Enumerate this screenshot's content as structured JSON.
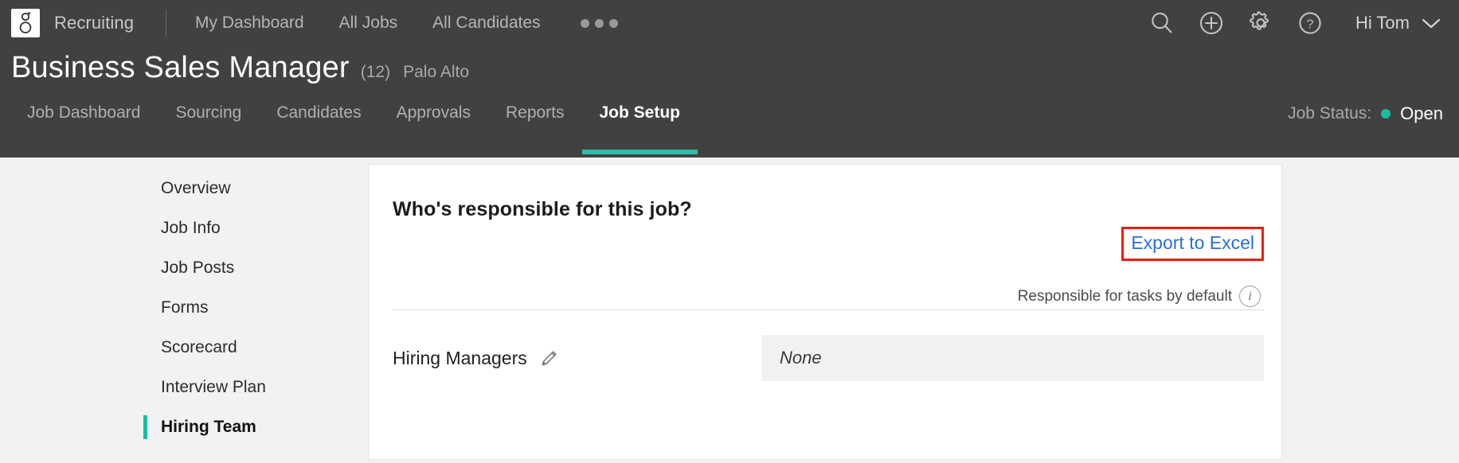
{
  "header": {
    "logo_icon": "greenhouse-g-logo-icon",
    "brand": "Recruiting",
    "nav_items": [
      {
        "label": "My Dashboard",
        "name": "my-dashboard"
      },
      {
        "label": "All Jobs",
        "name": "all-jobs"
      },
      {
        "label": "All Candidates",
        "name": "all-candidates"
      }
    ],
    "overflow_icon": "ellipsis-icon",
    "actions": [
      {
        "name": "search-icon",
        "label": "Search"
      },
      {
        "name": "plus-circle-icon",
        "label": "Create"
      },
      {
        "name": "gear-icon",
        "label": "Settings"
      },
      {
        "name": "question-circle-icon",
        "label": "Help"
      }
    ],
    "greeting": "Hi Tom",
    "greeting_caret_icon": "chevron-down-icon",
    "colors": {
      "topbar_bg": "#414141",
      "accent_teal": "#2bbfa8",
      "page_bg": "#f2f2f2"
    }
  },
  "job": {
    "title": "Business Sales Manager",
    "count": "(12)",
    "location": "Palo Alto",
    "status_label": "Job Status:",
    "status_value": "Open",
    "status_color": "#17bda0"
  },
  "tabs": [
    {
      "label": "Job Dashboard",
      "name": "job-dashboard",
      "active": false
    },
    {
      "label": "Sourcing",
      "name": "sourcing",
      "active": false
    },
    {
      "label": "Candidates",
      "name": "candidates",
      "active": false
    },
    {
      "label": "Approvals",
      "name": "approvals",
      "active": false
    },
    {
      "label": "Reports",
      "name": "reports",
      "active": false
    },
    {
      "label": "Job Setup",
      "name": "job-setup",
      "active": true
    }
  ],
  "sidebar": {
    "items": [
      {
        "label": "Overview",
        "name": "overview",
        "active": false
      },
      {
        "label": "Job Info",
        "name": "job-info",
        "active": false
      },
      {
        "label": "Job Posts",
        "name": "job-posts",
        "active": false
      },
      {
        "label": "Forms",
        "name": "forms",
        "active": false
      },
      {
        "label": "Scorecard",
        "name": "scorecard",
        "active": false
      },
      {
        "label": "Interview Plan",
        "name": "interview-plan",
        "active": false
      },
      {
        "label": "Hiring Team",
        "name": "hiring-team",
        "active": true
      }
    ]
  },
  "main": {
    "card_title": "Who's responsible for this job?",
    "export_link": "Export to Excel",
    "export_highlight_color": "#f31a13",
    "export_link_color": "#2a6fd6",
    "default_note": "Responsible for tasks by default",
    "info_icon": "info-circle-icon",
    "info_icon_glyph": "i",
    "rows": [
      {
        "label": "Hiring Managers",
        "edit_icon": "pencil-icon",
        "value": "None"
      }
    ]
  }
}
